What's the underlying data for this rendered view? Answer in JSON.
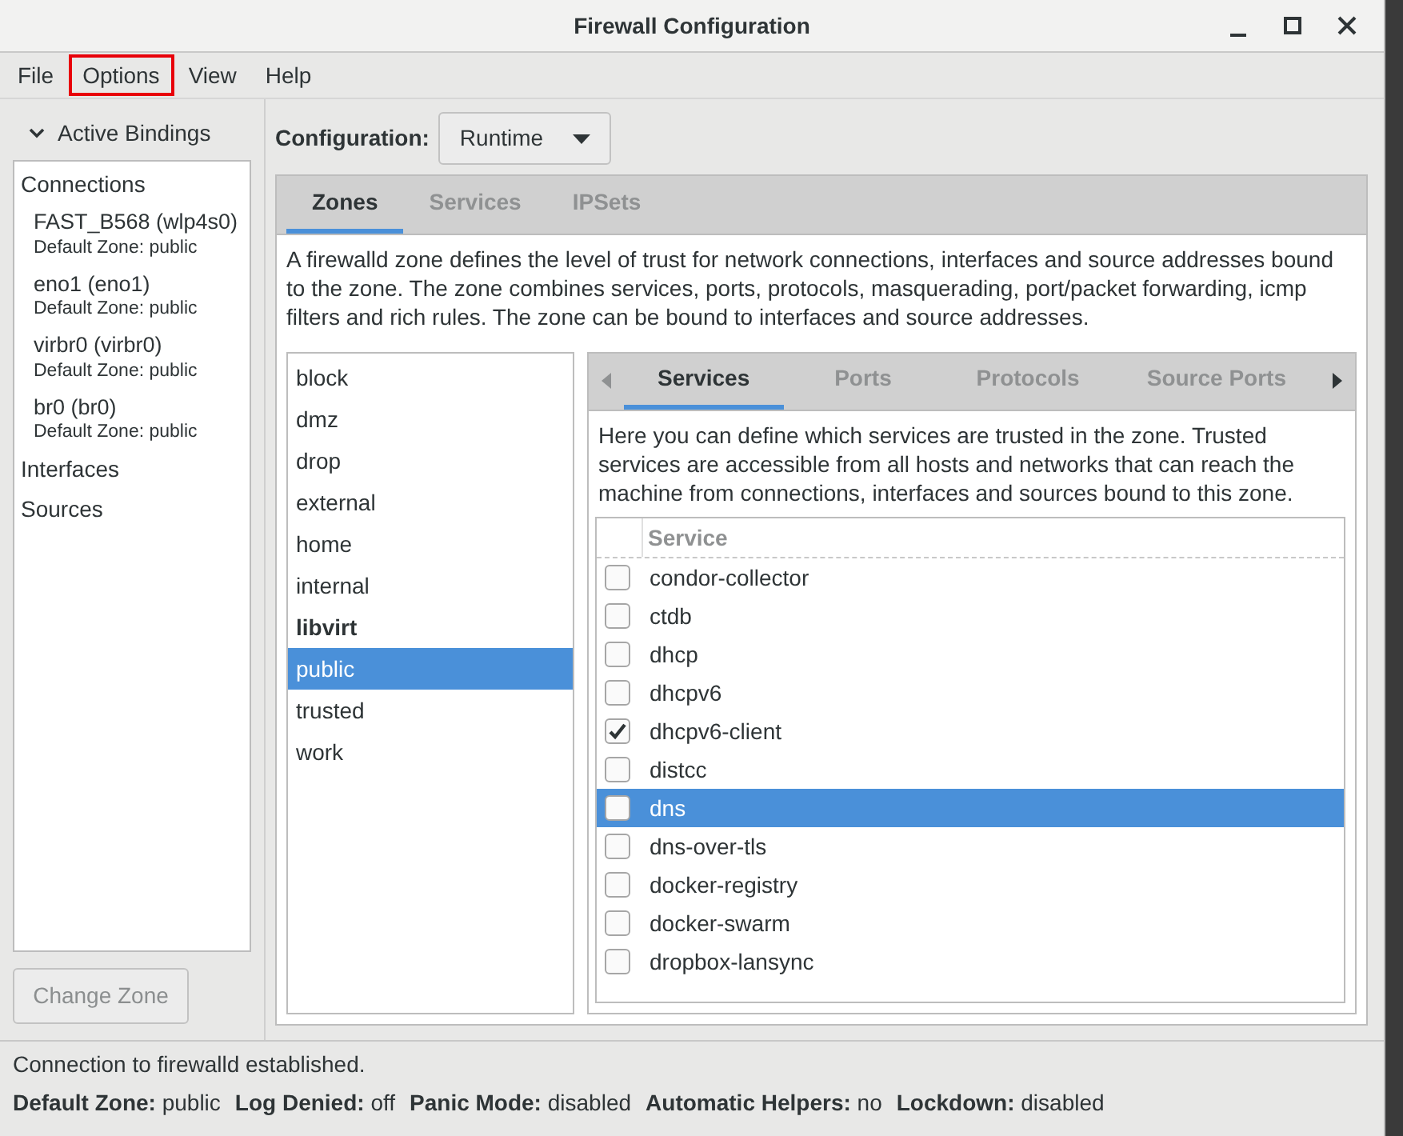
{
  "window": {
    "title": "Firewall Configuration"
  },
  "menu": [
    {
      "label": "File",
      "highlighted": false
    },
    {
      "label": "Options",
      "highlighted": true
    },
    {
      "label": "View",
      "highlighted": false
    },
    {
      "label": "Help",
      "highlighted": false
    }
  ],
  "bindings": {
    "title": "Active Bindings",
    "expanded": true,
    "groups": [
      {
        "label": "Connections",
        "children": [
          {
            "name": "FAST_B568 (wlp4s0)",
            "zone": "Default Zone: public"
          },
          {
            "name": "eno1 (eno1)",
            "zone": "Default Zone: public"
          },
          {
            "name": "virbr0 (virbr0)",
            "zone": "Default Zone: public"
          },
          {
            "name": "br0 (br0)",
            "zone": "Default Zone: public"
          }
        ]
      },
      {
        "label": "Interfaces"
      },
      {
        "label": "Sources"
      }
    ],
    "button": {
      "label": "Change Zone",
      "disabled": true
    }
  },
  "configuration": {
    "label": "Configuration:",
    "value": "Runtime"
  },
  "tabs": [
    {
      "label": "Zones",
      "selected": true
    },
    {
      "label": "Services",
      "selected": false
    },
    {
      "label": "IPSets",
      "selected": false
    }
  ],
  "zone_description": "A firewalld zone defines the level of trust for network connections, interfaces and source addresses bound to the zone. The zone combines services, ports, protocols, masquerading, port/packet forwarding, icmp filters and rich rules. The zone can be bound to interfaces and source addresses.",
  "zones": [
    {
      "name": "block",
      "selected": false,
      "bold": false
    },
    {
      "name": "dmz",
      "selected": false,
      "bold": false
    },
    {
      "name": "drop",
      "selected": false,
      "bold": false
    },
    {
      "name": "external",
      "selected": false,
      "bold": false
    },
    {
      "name": "home",
      "selected": false,
      "bold": false
    },
    {
      "name": "internal",
      "selected": false,
      "bold": false
    },
    {
      "name": "libvirt",
      "selected": false,
      "bold": true
    },
    {
      "name": "public",
      "selected": true,
      "bold": false
    },
    {
      "name": "trusted",
      "selected": false,
      "bold": false
    },
    {
      "name": "work",
      "selected": false,
      "bold": false
    }
  ],
  "zone_tabs": [
    {
      "label": "Services",
      "selected": true
    },
    {
      "label": "Ports",
      "selected": false
    },
    {
      "label": "Protocols",
      "selected": false
    },
    {
      "label": "Source Ports",
      "selected": false
    }
  ],
  "services_description": "Here you can define which services are trusted in the zone. Trusted services are accessible from all hosts and networks that can reach the machine from connections, interfaces and sources bound to this zone.",
  "services_table": {
    "column": "Service",
    "rows": [
      {
        "name": "condor-collector",
        "checked": false,
        "selected": false
      },
      {
        "name": "ctdb",
        "checked": false,
        "selected": false
      },
      {
        "name": "dhcp",
        "checked": false,
        "selected": false
      },
      {
        "name": "dhcpv6",
        "checked": false,
        "selected": false
      },
      {
        "name": "dhcpv6-client",
        "checked": true,
        "selected": false
      },
      {
        "name": "distcc",
        "checked": false,
        "selected": false
      },
      {
        "name": "dns",
        "checked": false,
        "selected": true
      },
      {
        "name": "dns-over-tls",
        "checked": false,
        "selected": false
      },
      {
        "name": "docker-registry",
        "checked": false,
        "selected": false
      },
      {
        "name": "docker-swarm",
        "checked": false,
        "selected": false
      },
      {
        "name": "dropbox-lansync",
        "checked": false,
        "selected": false
      }
    ]
  },
  "status_bar": {
    "message": "Connection to firewalld established.",
    "fields": [
      {
        "label": "Default Zone:",
        "value": "public"
      },
      {
        "label": "Log Denied:",
        "value": "off"
      },
      {
        "label": "Panic Mode:",
        "value": "disabled"
      },
      {
        "label": "Automatic Helpers:",
        "value": "no"
      },
      {
        "label": "Lockdown:",
        "value": "disabled"
      }
    ]
  }
}
